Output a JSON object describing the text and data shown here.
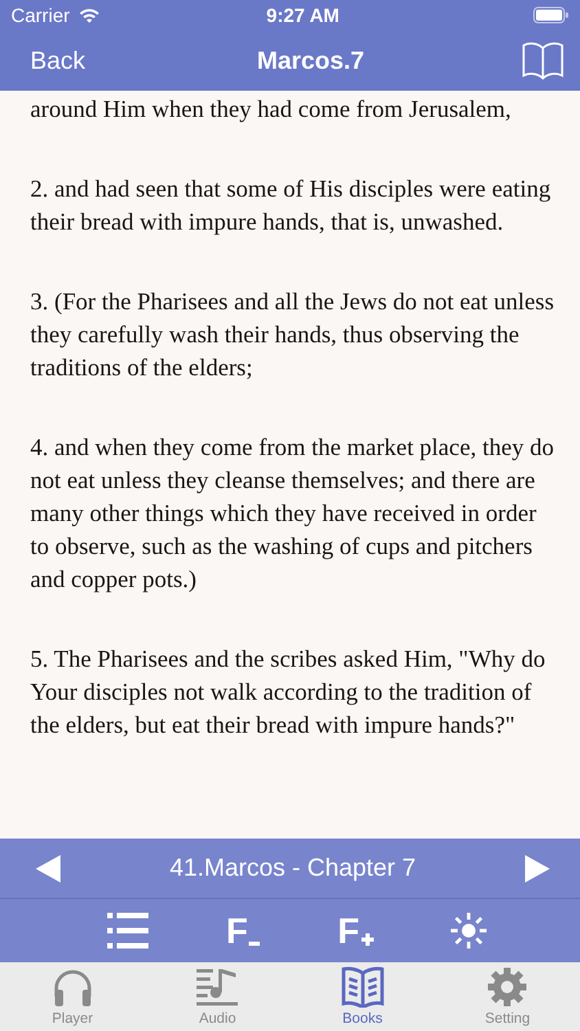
{
  "status_bar": {
    "carrier": "Carrier",
    "time": "9:27 AM"
  },
  "nav_bar": {
    "back": "Back",
    "title": "Marcos.7"
  },
  "verses": [
    "around Him when they had come from Jerusalem,",
    "2. and had seen that some of His disciples were eating their bread with impure hands, that is, unwashed.",
    "3. (For the Pharisees and all the Jews do not eat unless they carefully wash their hands, thus observing the traditions of the elders;",
    "4. and when they come from the market place, they do not eat unless they cleanse themselves; and there are many other things which they have received in order to observe, such as the washing of cups and pitchers and copper pots.)",
    "5. The Pharisees and the scribes asked Him, \"Why do Your disciples not walk according to the tradition of the elders, but eat their bread with impure hands?\""
  ],
  "chapter_bar": {
    "title": "41.Marcos - Chapter 7",
    "tools": [
      {
        "kind": "list"
      },
      {
        "kind": "font-smaller",
        "label": "F"
      },
      {
        "kind": "font-larger",
        "label": "F"
      },
      {
        "kind": "brightness"
      }
    ]
  },
  "tab_bar": [
    {
      "label": "Player",
      "kind": "headphones",
      "selected": false
    },
    {
      "label": "Audio",
      "kind": "music",
      "selected": false
    },
    {
      "label": "Books",
      "kind": "book",
      "selected": true
    },
    {
      "label": "Setting",
      "kind": "gear",
      "selected": false
    }
  ]
}
